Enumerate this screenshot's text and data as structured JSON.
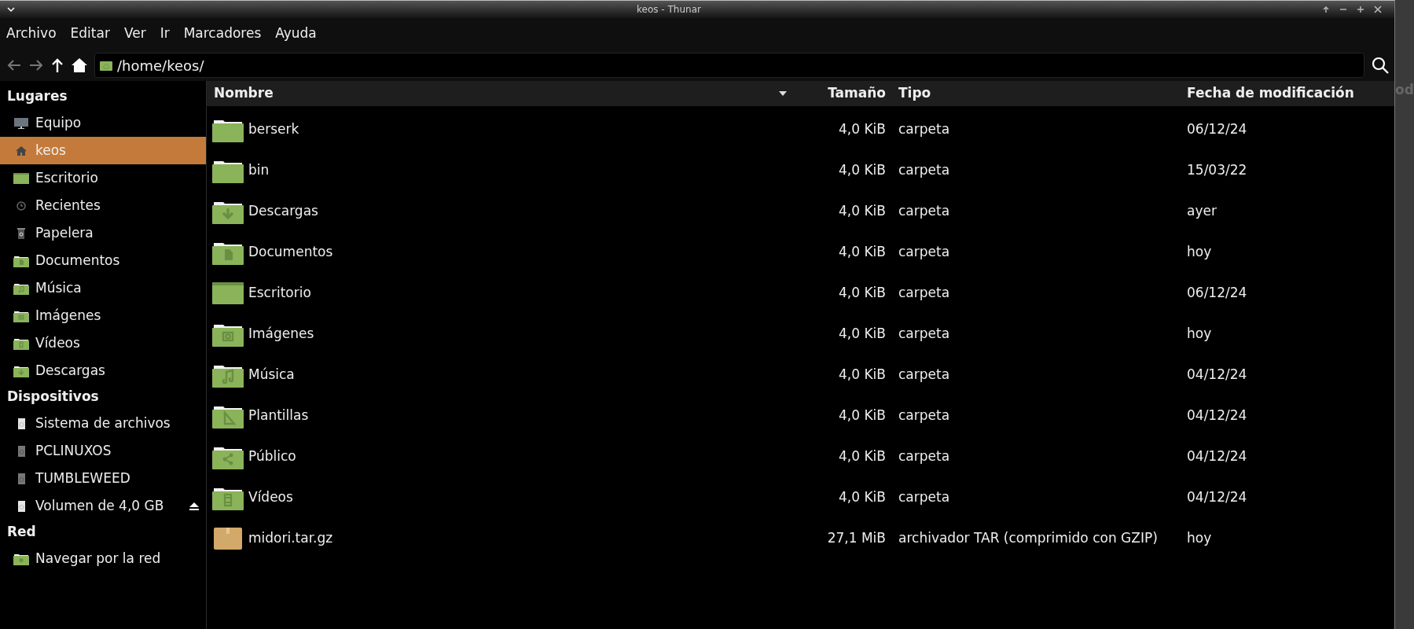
{
  "window": {
    "title": "keos - Thunar"
  },
  "menu": [
    "Archivo",
    "Editar",
    "Ver",
    "Ir",
    "Marcadores",
    "Ayuda"
  ],
  "location": {
    "value": "/home/keos/"
  },
  "sidebar": [
    {
      "heading": "Lugares",
      "items": [
        {
          "label": "Equipo",
          "kind": "computer",
          "selected": false
        },
        {
          "label": "keos",
          "kind": "home",
          "selected": true
        },
        {
          "label": "Escritorio",
          "kind": "desktop",
          "selected": false
        },
        {
          "label": "Recientes",
          "kind": "recent",
          "selected": false
        },
        {
          "label": "Papelera",
          "kind": "trash",
          "selected": false
        },
        {
          "label": "Documentos",
          "kind": "documents",
          "selected": false
        },
        {
          "label": "Música",
          "kind": "music",
          "selected": false
        },
        {
          "label": "Imágenes",
          "kind": "pictures",
          "selected": false
        },
        {
          "label": "Vídeos",
          "kind": "videos",
          "selected": false
        },
        {
          "label": "Descargas",
          "kind": "downloads",
          "selected": false
        }
      ]
    },
    {
      "heading": "Dispositivos",
      "items": [
        {
          "label": "Sistema de archivos",
          "kind": "drive",
          "mounted": true,
          "ejectable": false,
          "selected": false
        },
        {
          "label": "PCLINUXOS",
          "kind": "drive",
          "mounted": false,
          "ejectable": false,
          "selected": false
        },
        {
          "label": "TUMBLEWEED",
          "kind": "drive",
          "mounted": false,
          "ejectable": false,
          "selected": false
        },
        {
          "label": "Volumen de 4,0 GB",
          "kind": "drive",
          "mounted": true,
          "ejectable": true,
          "selected": false
        }
      ]
    },
    {
      "heading": "Red",
      "items": [
        {
          "label": "Navegar por la red",
          "kind": "network",
          "selected": false
        }
      ]
    }
  ],
  "table": {
    "columns": [
      "Nombre",
      "Tamaño",
      "Tipo",
      "Fecha de modificación"
    ],
    "rows": [
      {
        "name": "berserk",
        "kind": "folder",
        "size": "4,0 KiB",
        "type": "carpeta",
        "date": "06/12/24"
      },
      {
        "name": "bin",
        "kind": "folder",
        "size": "4,0 KiB",
        "type": "carpeta",
        "date": "15/03/22"
      },
      {
        "name": "Descargas",
        "kind": "downloads",
        "size": "4,0 KiB",
        "type": "carpeta",
        "date": "ayer"
      },
      {
        "name": "Documentos",
        "kind": "documents",
        "size": "4,0 KiB",
        "type": "carpeta",
        "date": "hoy"
      },
      {
        "name": "Escritorio",
        "kind": "desktop",
        "size": "4,0 KiB",
        "type": "carpeta",
        "date": "06/12/24"
      },
      {
        "name": "Imágenes",
        "kind": "pictures",
        "size": "4,0 KiB",
        "type": "carpeta",
        "date": "hoy"
      },
      {
        "name": "Música",
        "kind": "music",
        "size": "4,0 KiB",
        "type": "carpeta",
        "date": "04/12/24"
      },
      {
        "name": "Plantillas",
        "kind": "templates",
        "size": "4,0 KiB",
        "type": "carpeta",
        "date": "04/12/24"
      },
      {
        "name": "Público",
        "kind": "public",
        "size": "4,0 KiB",
        "type": "carpeta",
        "date": "04/12/24"
      },
      {
        "name": "Vídeos",
        "kind": "videos",
        "size": "4,0 KiB",
        "type": "carpeta",
        "date": "04/12/24"
      },
      {
        "name": "midori.tar.gz",
        "kind": "archive",
        "size": "27,1 MiB",
        "type": "archivador TAR (comprimido con GZIP)",
        "date": "hoy"
      }
    ]
  },
  "background_window_text": "od"
}
